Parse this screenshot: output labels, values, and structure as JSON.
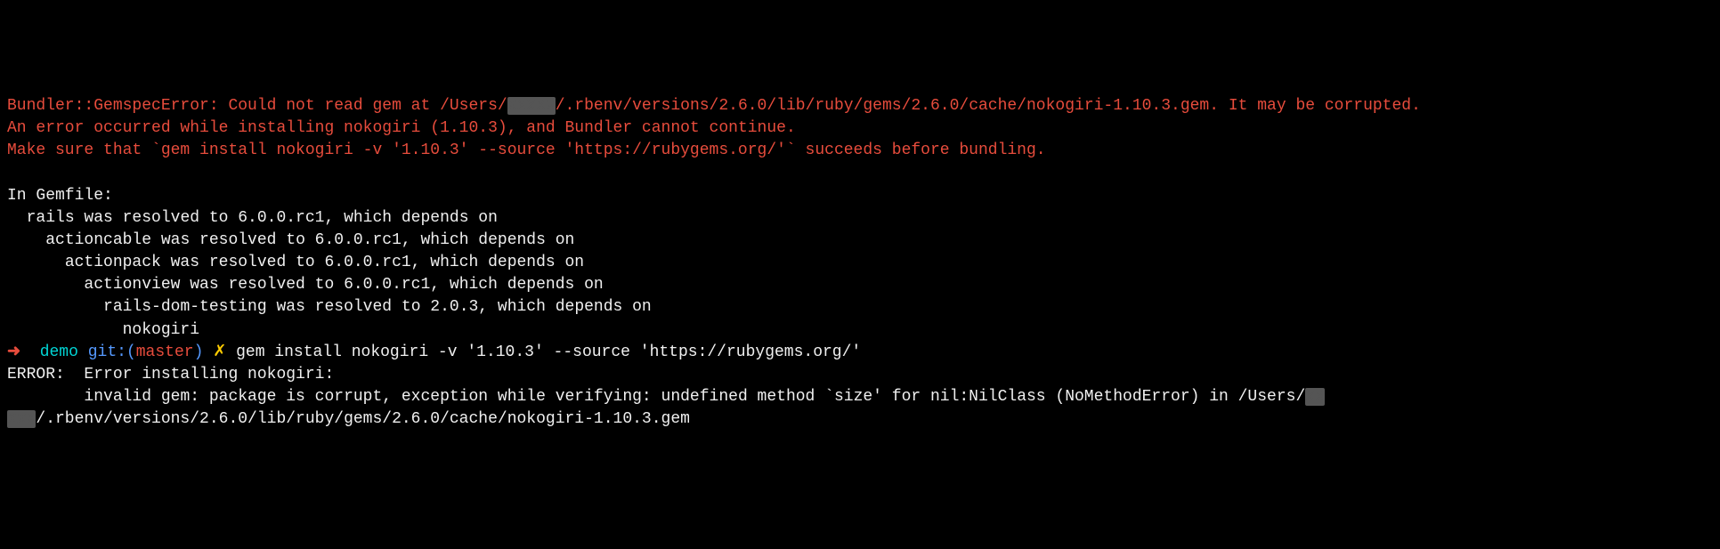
{
  "error": {
    "line1_part1": "Bundler::GemspecError: Could not read gem at /Users/",
    "line1_redacted": "xxxxx",
    "line1_part2": "/.rbenv/versions/2.6.0/lib/ruby/gems/2.6.0/cache/nokogiri-1.10.3.gem. It may be corrupted.",
    "line2": "An error occurred while installing nokogiri (1.10.3), and Bundler cannot continue.",
    "line3": "Make sure that `gem install nokogiri -v '1.10.3' --source 'https://rubygems.org/'` succeeds before bundling."
  },
  "gemfile": {
    "header": "In Gemfile:",
    "line1": "  rails was resolved to 6.0.0.rc1, which depends on",
    "line2": "    actioncable was resolved to 6.0.0.rc1, which depends on",
    "line3": "      actionpack was resolved to 6.0.0.rc1, which depends on",
    "line4": "        actionview was resolved to 6.0.0.rc1, which depends on",
    "line5": "          rails-dom-testing was resolved to 2.0.3, which depends on",
    "line6": "            nokogiri"
  },
  "prompt": {
    "arrow": "➜",
    "dir": "demo",
    "git_label": "git:(",
    "branch": "master",
    "git_close": ")",
    "dirty": "✗",
    "command": "gem install nokogiri -v '1.10.3' --source 'https://rubygems.org/'"
  },
  "output": {
    "line1": "ERROR:  Error installing nokogiri:",
    "line2_part1": "        invalid gem: package is corrupt, exception while verifying: undefined method `size' for nil:NilClass (NoMethodError) in /Users/",
    "line2_redacted1": "xx",
    "line3_redacted": "xxx",
    "line3_part2": "/.rbenv/versions/2.6.0/lib/ruby/gems/2.6.0/cache/nokogiri-1.10.3.gem"
  }
}
